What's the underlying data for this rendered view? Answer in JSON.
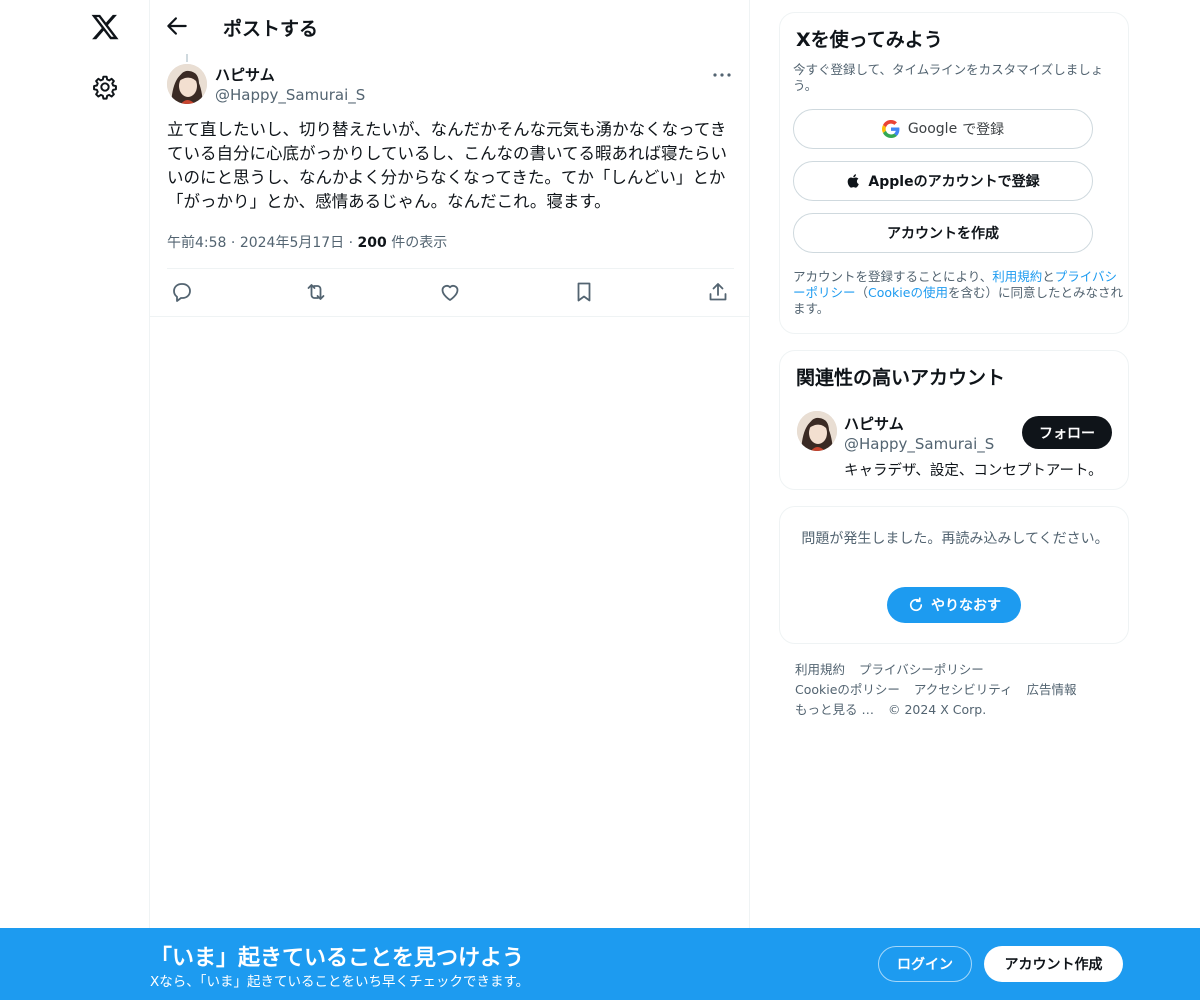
{
  "nav": {
    "logo_icon": "x-logo-icon",
    "settings_icon": "gear-icon"
  },
  "header": {
    "back_icon": "arrow-left-icon",
    "title": "ポストする"
  },
  "post": {
    "author_name": "ハピサム",
    "author_handle": "@Happy_Samurai_S",
    "text": "立て直したいし、切り替えたいが、なんだかそんな元気も湧かなくなってきている自分に心底がっかりしているし、こんなの書いてる暇あれば寝たらいいのにと思うし、なんかよく分からなくなってきた。てか「しんどい」とか「がっかり」とか、感情あるじゃん。なんだこれ。寝ます。",
    "time": "午前4:58",
    "date": "2024年5月17日",
    "views_count": "200",
    "views_label": "件の表示",
    "sep": "·",
    "actions": [
      "reply-icon",
      "repost-icon",
      "like-icon",
      "bookmark-icon",
      "share-icon"
    ]
  },
  "signup": {
    "title": "Xを使ってみよう",
    "subtitle": "今すぐ登録して、タイムラインをカスタマイズしましょう。",
    "google_label": "Google",
    "google_suffix": "で登録",
    "apple_label": "Appleのアカウントで登録",
    "create_label": "アカウントを作成",
    "terms_prefix": "アカウントを登録することにより、",
    "terms_link": "利用規約",
    "terms_and": "と",
    "privacy_link": "プライバシーポリシー",
    "cookie_open": "（",
    "cookie_link": "Cookieの使用",
    "terms_suffix": "を含む）に同意したとみなされます。"
  },
  "related": {
    "title": "関連性の高いアカウント",
    "name": "ハピサム",
    "handle": "@Happy_Samurai_S",
    "bio": "キャラデザ、設定、コンセプトアート。",
    "follow_label": "フォロー"
  },
  "error": {
    "message": "問題が発生しました。再読み込みしてください。",
    "retry_label": "やりなおす"
  },
  "footer": {
    "links": [
      "利用規約",
      "プライバシーポリシー",
      "Cookieのポリシー",
      "アクセシビリティ",
      "広告情報",
      "もっと見る …",
      "© 2024 X Corp."
    ]
  },
  "banner": {
    "title": "「いま」起きていることを見つけよう",
    "subtitle": "Xなら、「いま」起きていることをいち早くチェックできます。",
    "login_label": "ログイン",
    "create_label": "アカウント作成"
  },
  "colors": {
    "accent": "#1d9bf0",
    "text": "#0f1419",
    "muted": "#536471",
    "border": "#eff3f4"
  }
}
